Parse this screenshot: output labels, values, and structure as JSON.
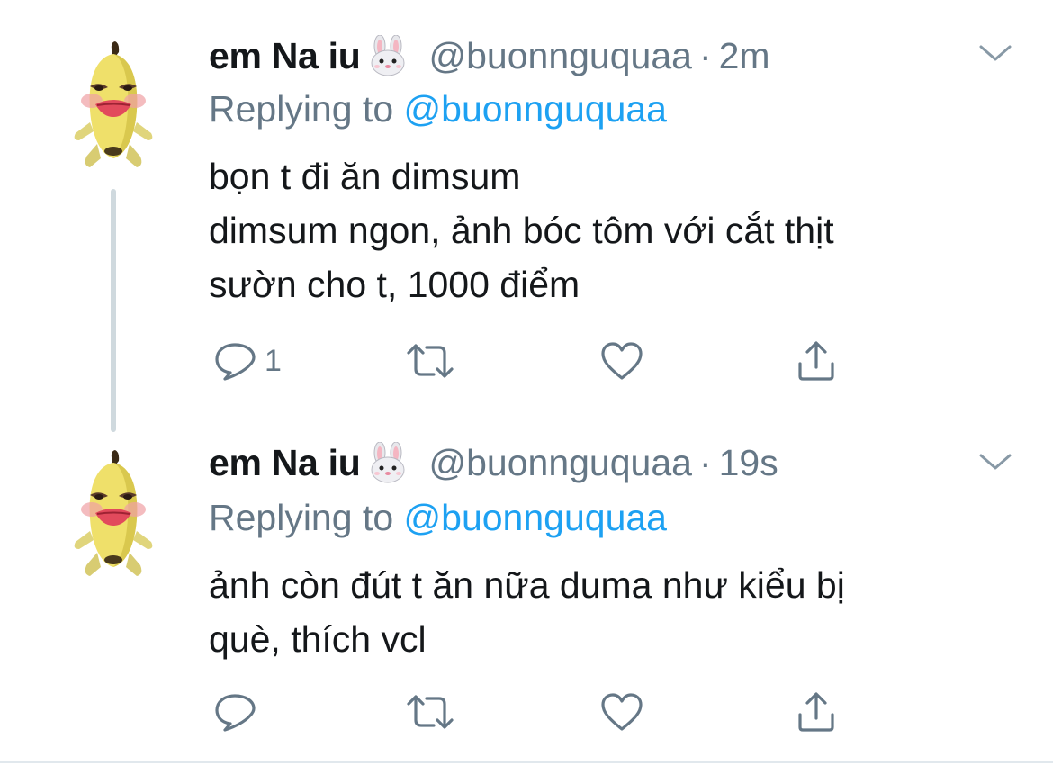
{
  "tweets": [
    {
      "display_name": "em Na iu",
      "name_emoji": "rabbit-face-emoji",
      "handle": "@buonnguquaa",
      "separator": "·",
      "time": "2m",
      "replying_prefix": "Replying to",
      "replying_handle": "@buonnguquaa",
      "text_lines": [
        "bọn t đi ăn dimsum",
        "dimsum ngon, ảnh bóc tôm với cắt thịt",
        "sườn cho t, 1000 điểm"
      ],
      "reply_count": "1",
      "avatar": "banana-meme-avatar"
    },
    {
      "display_name": "em Na iu",
      "name_emoji": "rabbit-face-emoji",
      "handle": "@buonnguquaa",
      "separator": "·",
      "time": "19s",
      "replying_prefix": "Replying to",
      "replying_handle": "@buonnguquaa",
      "text_lines": [
        "ảnh còn đút t ăn nữa duma như kiểu bị",
        "què, thích vcl"
      ],
      "reply_count": "",
      "avatar": "banana-meme-avatar"
    }
  ],
  "icons": {
    "reply": "reply-icon",
    "retweet": "retweet-icon",
    "like": "heart-icon",
    "share": "share-icon",
    "more": "chevron-down-icon"
  },
  "colors": {
    "text": "#14171a",
    "secondary": "#657786",
    "link": "#1da1f2",
    "thread_line": "#cfd9de",
    "background": "#ffffff"
  }
}
